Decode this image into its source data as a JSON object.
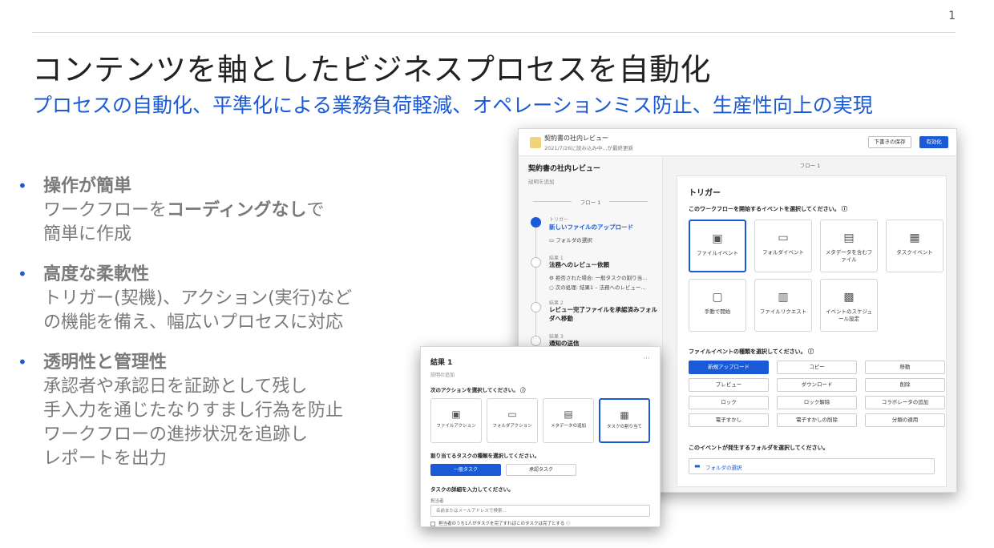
{
  "page_number": "1",
  "title": "コンテンツを軸としたビジネスプロセスを自動化",
  "subtitle": "プロセスの自動化、平準化による業務負荷軽減、オペレーションミス防止、生産性向上の実現",
  "bullets": [
    {
      "head": "操作が簡単",
      "line1_pre": "ワークフローを",
      "line1_bold": "コーディングなし",
      "line1_post": "で",
      "line2": "簡単に作成"
    },
    {
      "head": "高度な柔軟性",
      "lines": [
        "トリガー(契機)、アクション(実行)など",
        "の機能を備え、幅広いプロセスに対応"
      ]
    },
    {
      "head": "透明性と管理性",
      "lines": [
        "承認者や承認日を証跡として残し",
        "手入力を通じたなりすまし行為を防止",
        "ワークフローの進捗状況を追跡し",
        "レポートを出力"
      ]
    }
  ],
  "back_screen": {
    "app_name": "契約書の社内レビュー",
    "app_hint": "2021/7/26に読み込み中...が最終更新",
    "save_draft": "下書きの保存",
    "enable": "有効化",
    "workflow_name": "契約書の社内レビュー",
    "add_description": "説明を追加",
    "flow_label": "フロー 1",
    "steps": [
      {
        "caption": "トリガー",
        "title": "新しいファイルのアップロード",
        "sub": [
          "フォルダの選択"
        ]
      },
      {
        "caption": "結果 1",
        "title": "法務へのレビュー依頼",
        "sub": [
          "拒否された場合: 一般タスクの割り当...",
          "次の処理: 結果1 – 法務へのレビュー..."
        ]
      },
      {
        "caption": "結果 2",
        "title": "レビュー完了ファイルを承認済みフォルダへ移動",
        "sub": []
      },
      {
        "caption": "結果 3",
        "title": "通知の送信",
        "sub": []
      }
    ],
    "panel": {
      "flow_head": "フロー 1",
      "title": "トリガー",
      "q1": "このワークフローを開始するイベントを選択してください。 ⓘ",
      "events": [
        {
          "label": "ファイルイベント",
          "icon": "file-icon",
          "glyph": "▣"
        },
        {
          "label": "フォルダイベント",
          "icon": "folder-icon",
          "glyph": "▭"
        },
        {
          "label": "メタデータを含むファイル",
          "icon": "metadata-file-icon",
          "glyph": "▤"
        },
        {
          "label": "タスクイベント",
          "icon": "task-icon",
          "glyph": "▦"
        },
        {
          "label": "手動で開始",
          "icon": "manual-start-icon",
          "glyph": "▢"
        },
        {
          "label": "ファイルリクエスト",
          "icon": "file-request-icon",
          "glyph": "▥"
        },
        {
          "label": "イベントのスケジュール設定",
          "icon": "calendar-icon",
          "glyph": "▩"
        }
      ],
      "q2": "ファイルイベントの種類を選択してください。 ⓘ",
      "types": [
        "新規アップロード",
        "コピー",
        "移動",
        "プレビュー",
        "ダウンロード",
        "削除",
        "ロック",
        "ロック解除",
        "コラボレータの追加",
        "電子すかし",
        "電子すかしの削除",
        "分類の適用"
      ],
      "q3": "このイベントが発生するフォルダを選択してください。",
      "folder_select": "フォルダの選択"
    }
  },
  "front_screen": {
    "title": "結果 1",
    "more": "···",
    "desc": "説明の追加",
    "q1": "次のアクションを選択してください。 ⓘ",
    "actions": [
      {
        "label": "ファイルアクション",
        "icon": "file-action-icon",
        "glyph": "▣"
      },
      {
        "label": "フォルダアクション",
        "icon": "folder-action-icon",
        "glyph": "▭"
      },
      {
        "label": "メタデータの追加",
        "icon": "metadata-icon",
        "glyph": "▤"
      },
      {
        "label": "タスクの割り当て",
        "icon": "task-assign-icon",
        "glyph": "▦"
      }
    ],
    "q2": "割り当てるタスクの種類を選択してください。",
    "task_types": [
      "一般タスク",
      "承認タスク"
    ],
    "q3": "タスクの詳細を入力してください。",
    "assignee_label": "担当者",
    "assignee_placeholder": "名前またはメールアドレスで検索...",
    "checkbox_text": "担当者のうち1人がタスクを完了すればこのタスクは完了とする ⓘ"
  }
}
